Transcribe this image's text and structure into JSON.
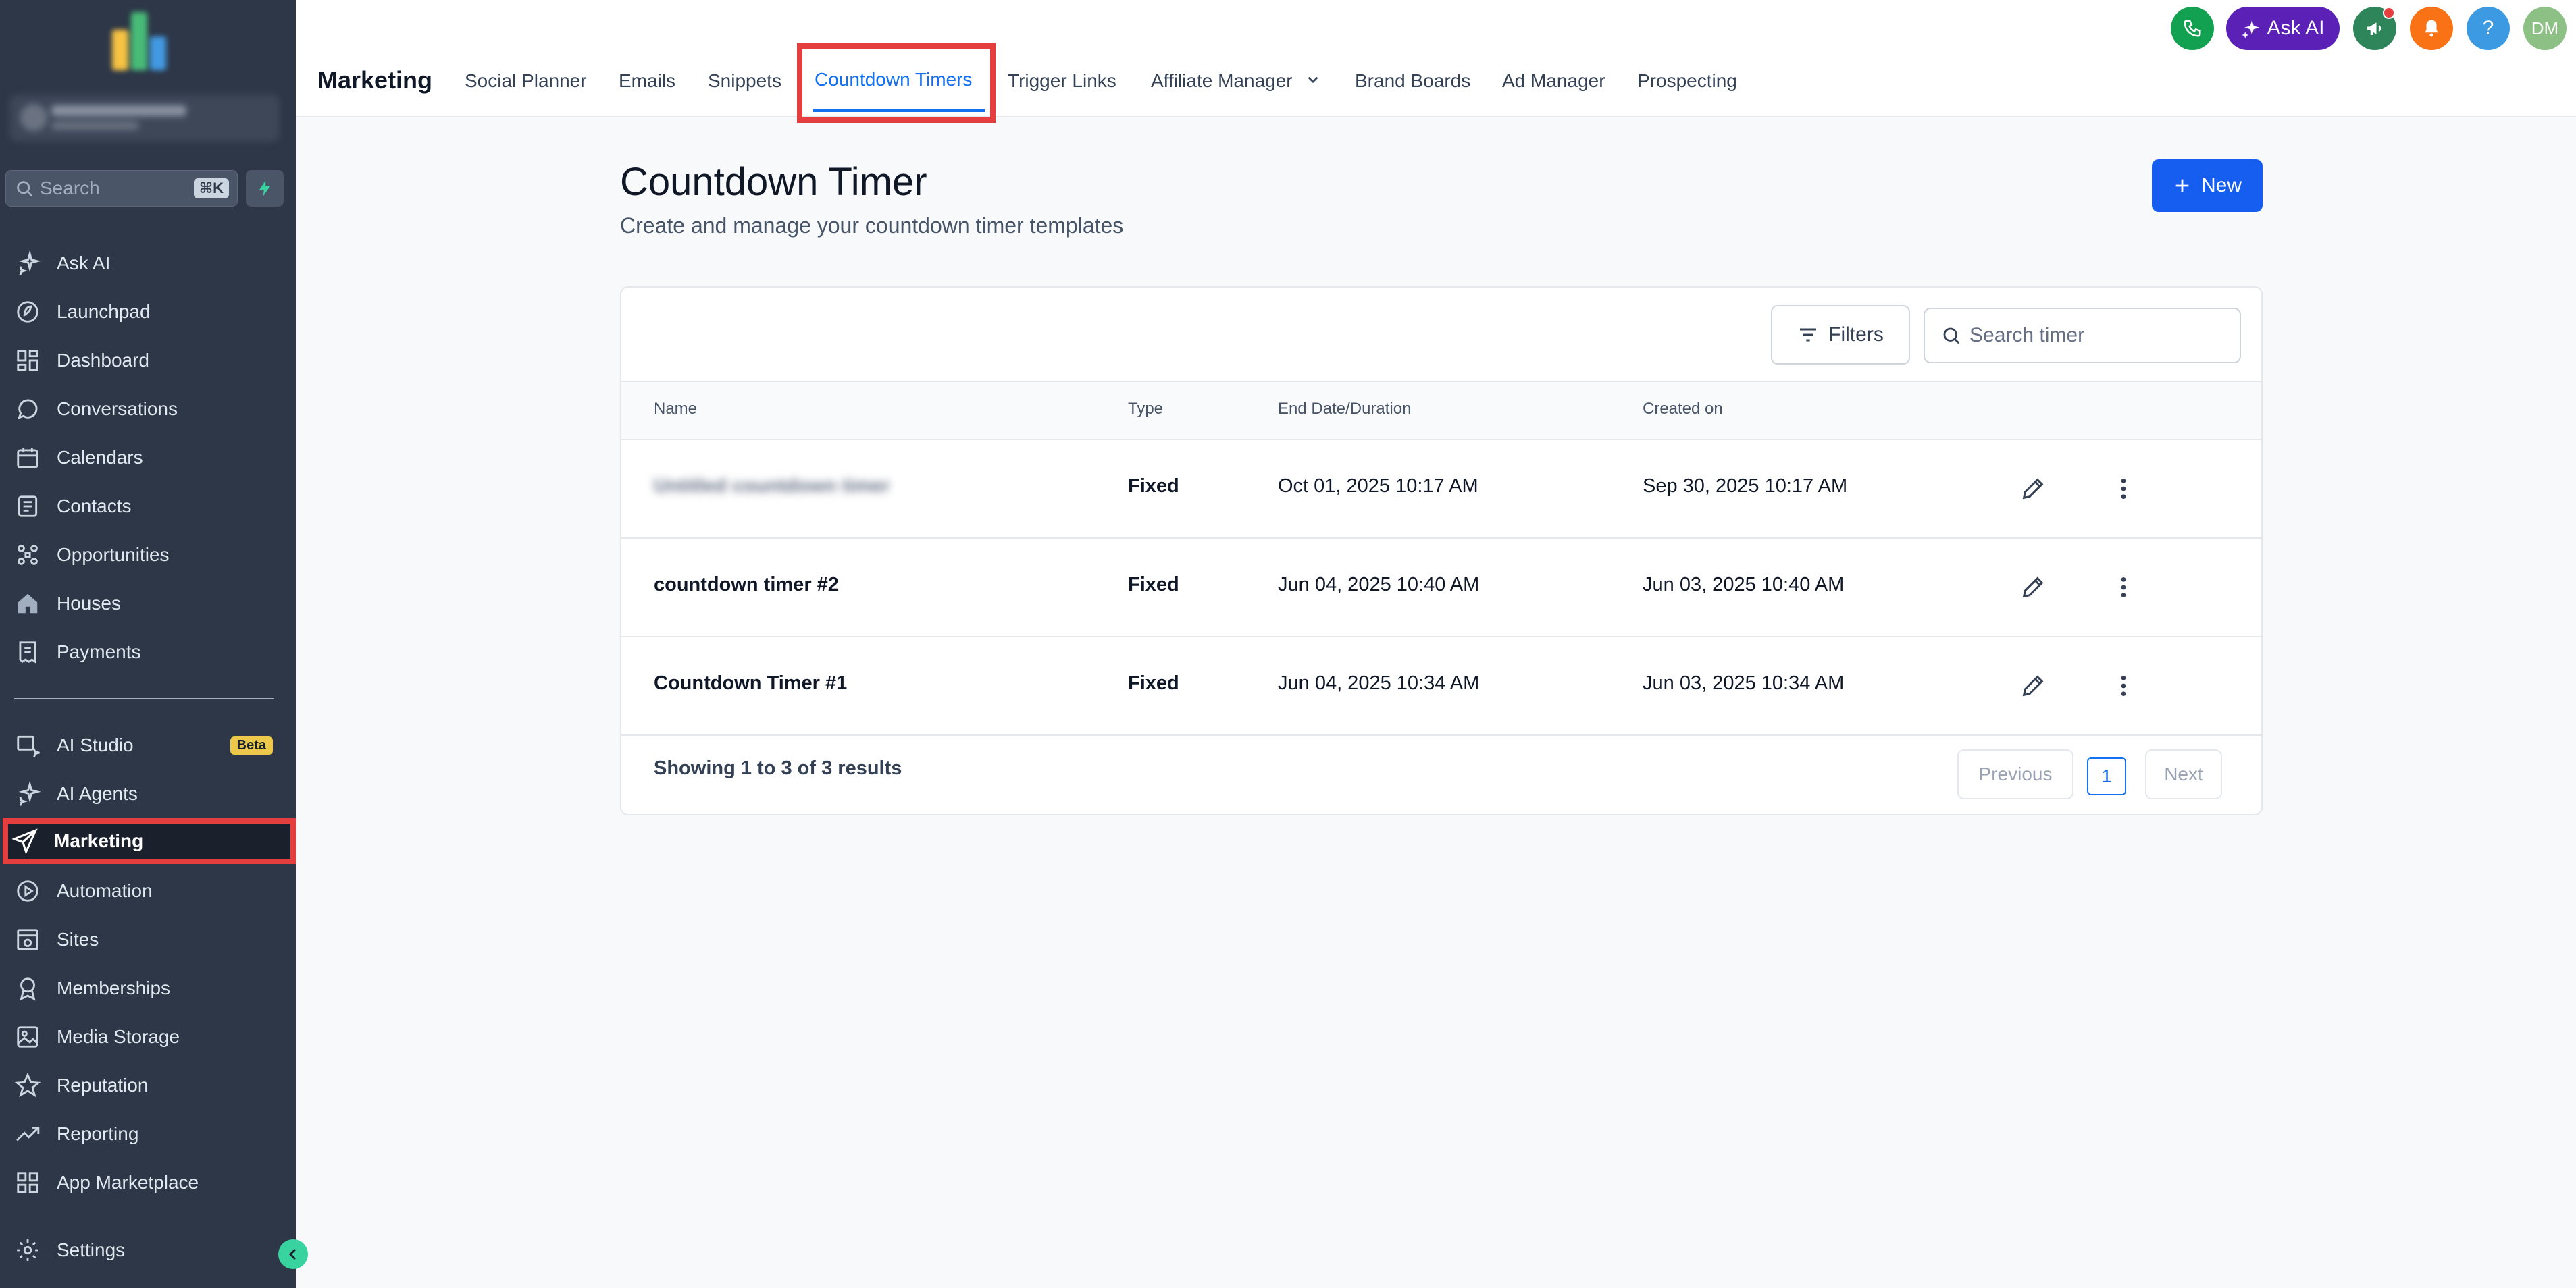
{
  "sidebar": {
    "search_placeholder": "Search",
    "search_shortcut": "⌘K",
    "items": [
      {
        "label": "Ask AI",
        "icon": "sparkle-icon"
      },
      {
        "label": "Launchpad",
        "icon": "rocket-icon"
      },
      {
        "label": "Dashboard",
        "icon": "grid-icon"
      },
      {
        "label": "Conversations",
        "icon": "chat-icon"
      },
      {
        "label": "Calendars",
        "icon": "calendar-icon"
      },
      {
        "label": "Contacts",
        "icon": "contacts-icon"
      },
      {
        "label": "Opportunities",
        "icon": "opportunities-icon"
      },
      {
        "label": "Houses",
        "icon": "house-icon"
      },
      {
        "label": "Payments",
        "icon": "receipt-icon"
      },
      {
        "label": "AI Studio",
        "icon": "ai-studio-icon",
        "badge": "Beta"
      },
      {
        "label": "AI Agents",
        "icon": "sparkle-icon"
      },
      {
        "label": "Marketing",
        "icon": "send-icon",
        "active": true
      },
      {
        "label": "Automation",
        "icon": "automation-icon"
      },
      {
        "label": "Sites",
        "icon": "sites-icon"
      },
      {
        "label": "Memberships",
        "icon": "award-icon"
      },
      {
        "label": "Media Storage",
        "icon": "image-icon"
      },
      {
        "label": "Reputation",
        "icon": "star-icon"
      },
      {
        "label": "Reporting",
        "icon": "trend-icon"
      },
      {
        "label": "App Marketplace",
        "icon": "apps-icon"
      },
      {
        "label": "Settings",
        "icon": "gear-icon"
      }
    ]
  },
  "topbar": {
    "section_title": "Marketing",
    "tabs": [
      {
        "label": "Social Planner"
      },
      {
        "label": "Emails"
      },
      {
        "label": "Snippets"
      },
      {
        "label": "Countdown Timers",
        "active": true
      },
      {
        "label": "Trigger Links"
      },
      {
        "label": "Affiliate Manager"
      },
      {
        "label": "Brand Boards"
      },
      {
        "label": "Ad Manager"
      },
      {
        "label": "Prospecting"
      }
    ],
    "ask_ai_label": "Ask AI",
    "help_label": "?",
    "avatar_initials": "DM",
    "colors": {
      "phone": "#12a150",
      "ask_ai": "#5b21b6",
      "megaphone": "#2f855a",
      "bell": "#f97316",
      "help": "#3b9ae1",
      "avatar": "#8cc084"
    }
  },
  "page": {
    "title": "Countdown Timer",
    "subtitle": "Create and manage your countdown timer templates",
    "new_button": "New",
    "filters_label": "Filters",
    "search_placeholder": "Search timer"
  },
  "table": {
    "columns": [
      "Name",
      "Type",
      "End Date/Duration",
      "Created on"
    ],
    "rows": [
      {
        "name": "Untitled countdown timer",
        "type": "Fixed",
        "end": "Oct 01, 2025 10:17 AM",
        "created": "Sep 30, 2025 10:17 AM",
        "blurred": true
      },
      {
        "name": "countdown timer #2",
        "type": "Fixed",
        "end": "Jun 04, 2025 10:40 AM",
        "created": "Jun 03, 2025 10:40 AM"
      },
      {
        "name": "Countdown Timer #1",
        "type": "Fixed",
        "end": "Jun 04, 2025 10:34 AM",
        "created": "Jun 03, 2025 10:34 AM"
      }
    ],
    "footer": "Showing 1 to 3 of 3 results",
    "pagination": {
      "previous": "Previous",
      "current": "1",
      "next": "Next"
    }
  }
}
